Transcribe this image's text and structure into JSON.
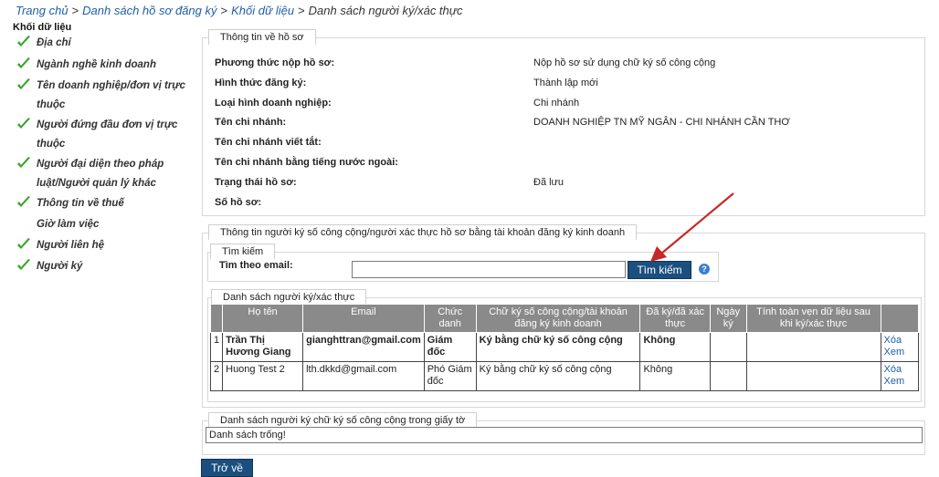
{
  "breadcrumb": {
    "home": "Trang chủ",
    "list": "Danh sách hồ sơ đăng ký",
    "block": "Khối dữ liệu",
    "current": "Danh sách người ký/xác thực",
    "separator": ">"
  },
  "sidebar": {
    "title": "Khối dữ liệu",
    "items": [
      {
        "label": "Địa chỉ",
        "checked": true
      },
      {
        "label": "Ngành nghề kinh doanh",
        "checked": true
      },
      {
        "label": "Tên doanh nghiệp/đơn vị trực thuộc",
        "checked": true
      },
      {
        "label": "Người đứng đầu đơn vị trực thuộc",
        "checked": true
      },
      {
        "label": "Người đại diện theo pháp luật/Người quản lý khác",
        "checked": true
      },
      {
        "label": "Thông tin về thuế",
        "checked": true
      },
      {
        "label": "Giờ làm việc",
        "checked": false
      },
      {
        "label": "Người liên hệ",
        "checked": true
      },
      {
        "label": "Người ký",
        "checked": true
      }
    ],
    "check_color": "#3aa52a"
  },
  "profile": {
    "legend": "Thông tin về hồ sơ",
    "rows": [
      {
        "label": "Phương thức nộp hồ sơ:",
        "value": "Nộp hồ sơ sử dụng chữ ký số công cộng"
      },
      {
        "label": "Hình thức đăng ký:",
        "value": "Thành lập mới"
      },
      {
        "label": "Loại hình doanh nghiệp:",
        "value": "Chi nhánh"
      },
      {
        "label": "Tên chi nhánh:",
        "value": "DOANH NGHIỆP TN MỸ NGÂN - CHI NHÁNH CẦN THƠ"
      },
      {
        "label": "Tên chi nhánh viết tắt:",
        "value": ""
      },
      {
        "label": "Tên chi nhánh bằng tiếng nước ngoài:",
        "value": ""
      },
      {
        "label": "Trạng thái hồ sơ:",
        "value": "Đã lưu"
      },
      {
        "label": "Số hồ sơ:",
        "value": ""
      }
    ]
  },
  "signers": {
    "legend": "Thông tin người ký số công cộng/người xác thực hồ sơ bằng tài khoản đăng ký kinh doanh",
    "search": {
      "legend": "Tìm kiếm",
      "label": "Tìm theo email:",
      "value": "",
      "placeholder": "",
      "button": "Tìm kiếm",
      "help_icon": "?"
    },
    "list_legend": "Danh sách người ký/xác thực",
    "columns": [
      "",
      "Họ tên",
      "Email",
      "Chức danh",
      "Chữ ký số công cộng/tài khoản đăng ký kinh doanh",
      "Đã ký/đã xác thực",
      "Ngày ký",
      "Tính toàn vẹn dữ liệu sau khi ký/xác thực",
      ""
    ],
    "rows": [
      {
        "no": "1",
        "name": "Trần Thị Hương Giang",
        "email": "gianghttran@gmail.com",
        "title": "Giám đốc",
        "method": "Ký bằng chữ ký số công cộng",
        "signed": "Không",
        "date": "",
        "integrity": "",
        "delete": "Xóa",
        "view": "Xem"
      },
      {
        "no": "2",
        "name": "Huong Test 2",
        "email": "lth.dkkd@gmail.com",
        "title": "Phó Giám đốc",
        "method": "Ký bằng chữ ký số công cộng",
        "signed": "Không",
        "date": "",
        "integrity": "",
        "delete": "Xóa",
        "view": "Xem"
      }
    ]
  },
  "docs": {
    "legend": "Danh sách người ký chữ ký số công cộng trong giấy tờ",
    "empty": "Danh sách trống!"
  },
  "back_button": "Trở về",
  "colors": {
    "accent": "#1b4f7e",
    "link": "#1f5fa8",
    "header_bg": "#8a8a8a",
    "arrow": "#c62828"
  }
}
